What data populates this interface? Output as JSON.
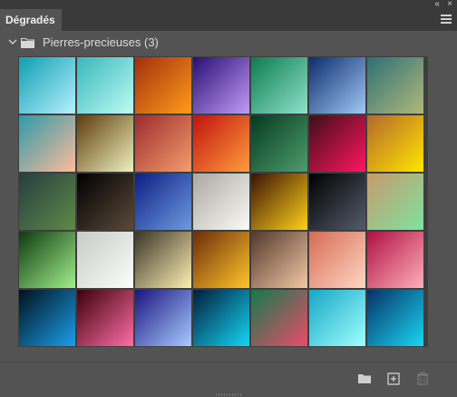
{
  "panel": {
    "tab_label": "Dégradés",
    "group_label": "Pierres-precieuses (3)",
    "icons": {
      "collapse": "double-chevron-left-icon",
      "menu": "hamburger-menu-icon",
      "chevron": "chevron-down-icon",
      "folder": "folder-icon",
      "new_group": "new-folder-icon",
      "new_gradient": "add-icon",
      "delete": "trash-icon"
    }
  },
  "gradients": [
    {
      "colors": [
        "#0e9fb0",
        "#b7f0ff"
      ]
    },
    {
      "colors": [
        "#3ab7bd",
        "#bdfcf3"
      ]
    },
    {
      "colors": [
        "#a2300f",
        "#ff9b1a"
      ]
    },
    {
      "colors": [
        "#2a0e74",
        "#c19cf6"
      ]
    },
    {
      "colors": [
        "#0c7a52",
        "#8fe3c9"
      ]
    },
    {
      "colors": [
        "#0c2d6c",
        "#a1c8f6"
      ]
    },
    {
      "colors": [
        "#2d6f76",
        "#b0b97a"
      ]
    },
    {
      "colors": [
        "#2d9aab",
        "#ffbc9a"
      ]
    },
    {
      "colors": [
        "#5e3d0b",
        "#f0f0c0"
      ]
    },
    {
      "colors": [
        "#9b2c2d",
        "#f59d6d"
      ]
    },
    {
      "colors": [
        "#c2120e",
        "#ff9d3e"
      ]
    },
    {
      "colors": [
        "#053a1d",
        "#4e9d6d"
      ]
    },
    {
      "colors": [
        "#3e0e18",
        "#ff165f"
      ]
    },
    {
      "colors": [
        "#b4682c",
        "#ffe600"
      ]
    },
    {
      "colors": [
        "#263d41",
        "#5e8a46"
      ]
    },
    {
      "colors": [
        "#000000",
        "#5a4a3a"
      ]
    },
    {
      "colors": [
        "#0c1e84",
        "#6d9bdf"
      ]
    },
    {
      "colors": [
        "#aaa8a0",
        "#fbfbf7"
      ]
    },
    {
      "colors": [
        "#3a1203",
        "#ffd21a"
      ]
    },
    {
      "colors": [
        "#000000",
        "#545c6c"
      ]
    },
    {
      "colors": [
        "#c79a6d",
        "#7fe39f"
      ]
    },
    {
      "colors": [
        "#0e3a10",
        "#a2f08d"
      ]
    },
    {
      "colors": [
        "#c5ccc5",
        "#fdfdfd"
      ]
    },
    {
      "colors": [
        "#3a3527",
        "#fff0b4"
      ]
    },
    {
      "colors": [
        "#6e2b09",
        "#ffc62b"
      ]
    },
    {
      "colors": [
        "#52372b",
        "#f3c9a6"
      ]
    },
    {
      "colors": [
        "#d66b53",
        "#ffd7c4"
      ]
    },
    {
      "colors": [
        "#b00f43",
        "#ffb0b8"
      ]
    },
    {
      "colors": [
        "#00111c",
        "#1c9eea"
      ]
    },
    {
      "colors": [
        "#3c0009",
        "#ff6ea7"
      ]
    },
    {
      "colors": [
        "#1b147e",
        "#a8cbff"
      ]
    },
    {
      "colors": [
        "#011d3a",
        "#15d6f5"
      ]
    },
    {
      "colors": [
        "#127a4e",
        "#ec4d6a"
      ]
    },
    {
      "colors": [
        "#16a7c5",
        "#a1ffff"
      ]
    },
    {
      "colors": [
        "#063167",
        "#1ad6f3"
      ]
    }
  ]
}
